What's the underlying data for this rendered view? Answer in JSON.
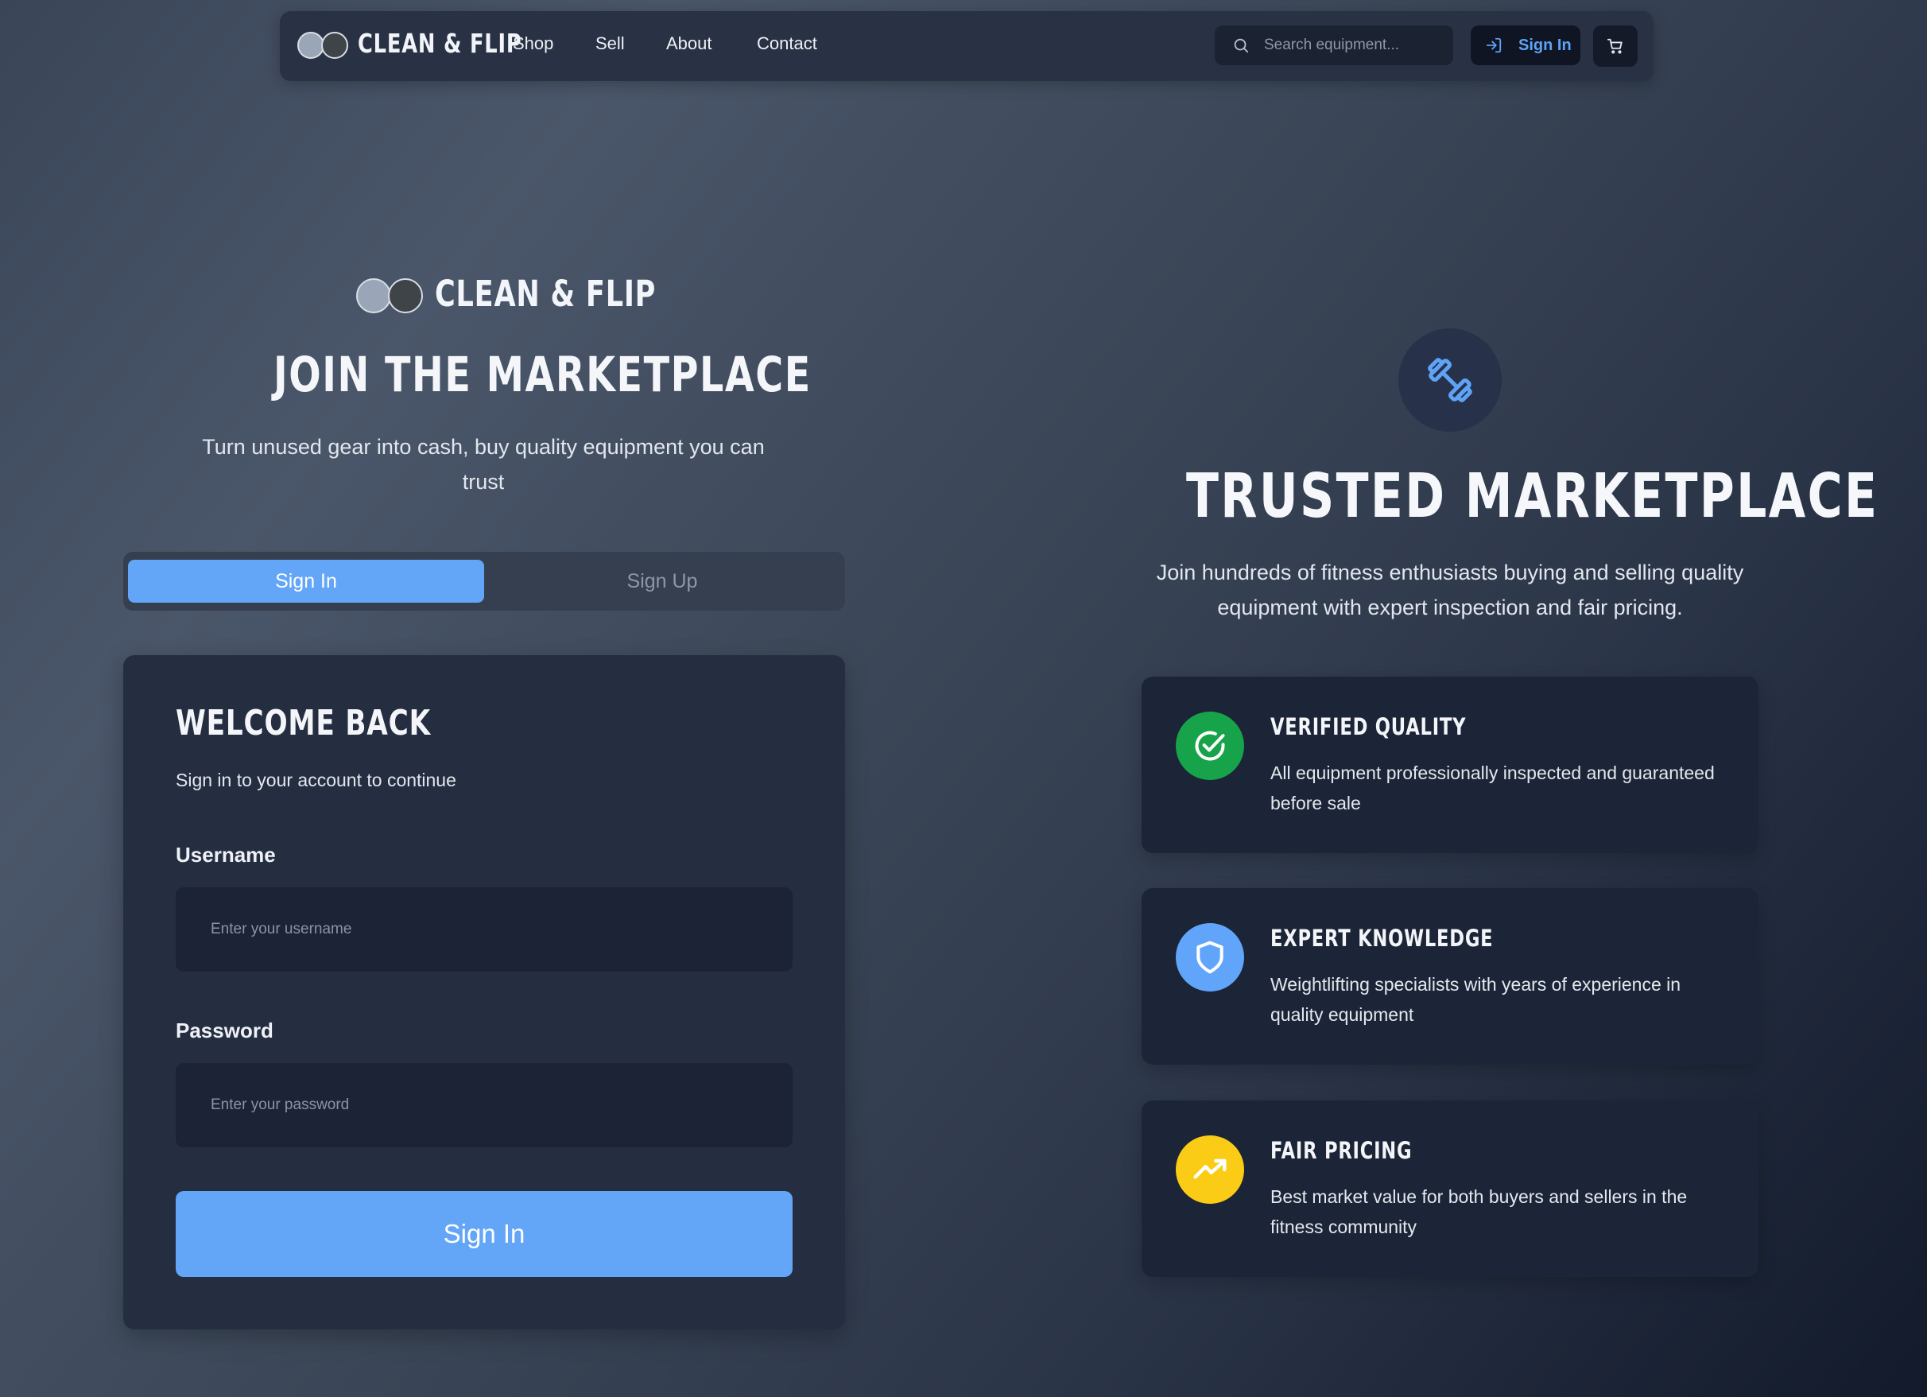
{
  "nav": {
    "brand": "CLEAN & FLIP",
    "links": [
      "Shop",
      "Sell",
      "About",
      "Contact"
    ],
    "search_placeholder": "Search equipment...",
    "sign_in_label": "Sign In",
    "icons": [
      "search-icon",
      "sign-in-icon",
      "cart-icon"
    ]
  },
  "hero": {
    "brand": "CLEAN & FLIP",
    "title": "JOIN THE MARKETPLACE",
    "subtitle": "Turn unused gear into cash, buy quality equipment you can trust"
  },
  "tabs": [
    {
      "label": "Sign In",
      "active": true
    },
    {
      "label": "Sign Up",
      "active": false
    }
  ],
  "login": {
    "title": "WELCOME BACK",
    "subtitle": "Sign in to your account to continue",
    "username_label": "Username",
    "username_placeholder": "Enter your username",
    "password_label": "Password",
    "password_placeholder": "Enter your password",
    "submit_label": "Sign In"
  },
  "trust": {
    "icon": "dumbbell-icon",
    "title": "TRUSTED MARKETPLACE",
    "subtitle": "Join hundreds of fitness enthusiasts buying and selling quality equipment with expert inspection and fair pricing.",
    "features": [
      {
        "icon": "check-circle-icon",
        "color": "#16a34a",
        "title": "VERIFIED QUALITY",
        "description": "All equipment professionally inspected and guaranteed before sale"
      },
      {
        "icon": "shield-icon",
        "color": "#60a5fa",
        "title": "EXPERT KNOWLEDGE",
        "description": "Weightlifting specialists with years of experience in quality equipment"
      },
      {
        "icon": "trending-up-icon",
        "color": "#facc15",
        "title": "FAIR PRICING",
        "description": "Best market value for both buyers and sellers in the fitness community"
      }
    ]
  },
  "colors": {
    "accent": "#63a5f7",
    "card_bg": "#252e41",
    "nav_bg": "#293244"
  }
}
